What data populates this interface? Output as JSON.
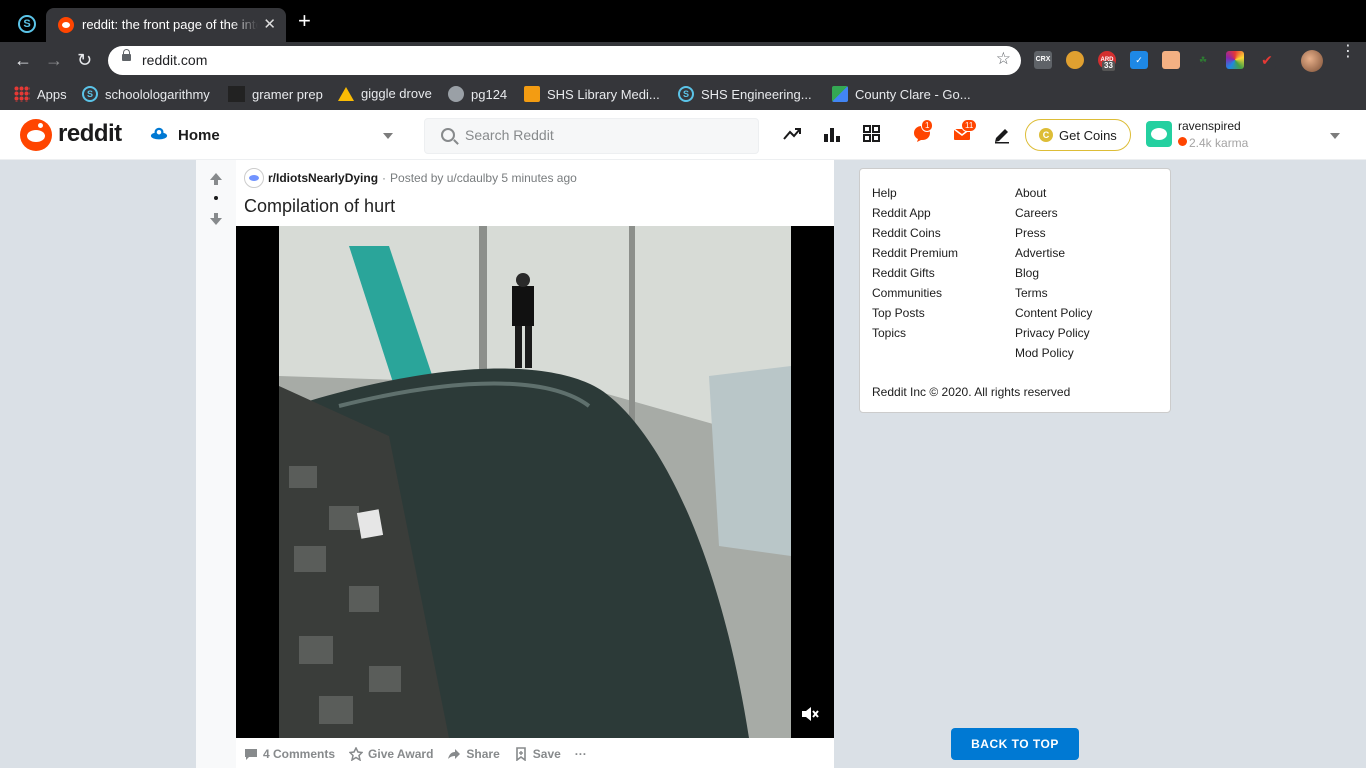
{
  "browser": {
    "tab_title": "reddit: the front page of the internet",
    "url": "reddit.com",
    "new_tab": "+",
    "close": "✕",
    "extensions": [
      {
        "name": "CRX",
        "color": "#5f6368"
      },
      {
        "name": "ARD",
        "badge": "33",
        "color": "#d32f2f"
      }
    ],
    "bookmarks": [
      {
        "label": "Apps",
        "icon": "apps-grid-icon"
      },
      {
        "label": "schoolologarithmy",
        "icon": "schoology-icon"
      },
      {
        "label": "gramer prep",
        "icon": "gbi-icon"
      },
      {
        "label": "giggle drove",
        "icon": "drive-icon"
      },
      {
        "label": "pg124",
        "icon": "globe-icon"
      },
      {
        "label": "SHS Library Medi...",
        "icon": "library-icon"
      },
      {
        "label": "SHS Engineering...",
        "icon": "schoology-icon"
      },
      {
        "label": "County Clare - Go...",
        "icon": "maps-icon"
      }
    ]
  },
  "header": {
    "brand": "reddit",
    "feed": "Home",
    "search_placeholder": "Search Reddit",
    "chat_count": "1",
    "mail_count": "11",
    "coins_label": "Get Coins",
    "username": "ravenspired",
    "karma": "2.4k karma"
  },
  "post": {
    "subreddit": "r/IdiotsNearlyDying",
    "separator": "·",
    "posted_by": "Posted by u/cdaulby 5 minutes ago",
    "title": "Compilation of hurt",
    "actions": {
      "comments": "4 Comments",
      "award": "Give Award",
      "share": "Share",
      "save": "Save",
      "more": "···"
    }
  },
  "sidebar": {
    "left_links": [
      "Help",
      "Reddit App",
      "Reddit Coins",
      "Reddit Premium",
      "Reddit Gifts",
      "Communities",
      "Top Posts",
      "Topics"
    ],
    "right_links": [
      "About",
      "Careers",
      "Press",
      "Advertise",
      "Blog",
      "Terms",
      "Content Policy",
      "Privacy Policy",
      "Mod Policy"
    ],
    "copyright": "Reddit Inc © 2020. All rights reserved"
  },
  "back_to_top": "BACK TO TOP",
  "colors": {
    "reddit_orange": "#ff4500",
    "link_blue": "#0079d3",
    "coin_gold": "#ddbd37",
    "page_bg": "#dae0e6"
  }
}
